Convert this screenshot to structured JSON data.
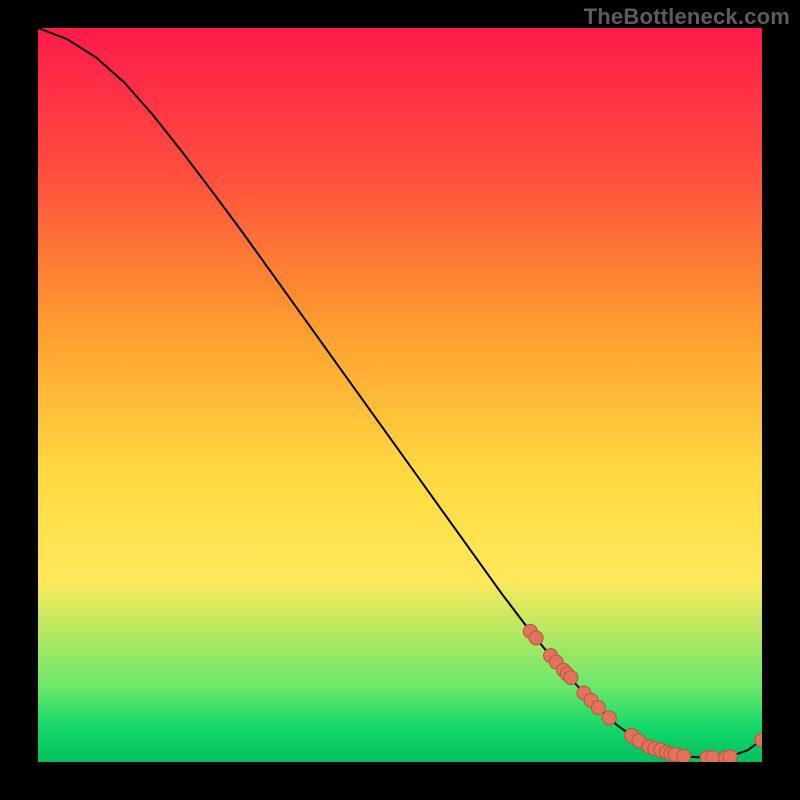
{
  "watermark": "TheBottleneck.com",
  "chart_data": {
    "type": "line",
    "title": "",
    "xlabel": "",
    "ylabel": "",
    "xlim": [
      0,
      100
    ],
    "ylim": [
      0,
      100
    ],
    "grid": false,
    "gradient_stops": [
      {
        "offset": 0.0,
        "color": "#ff1a4b"
      },
      {
        "offset": 0.2,
        "color": "#ff4f3e"
      },
      {
        "offset": 0.4,
        "color": "#ff9a2f"
      },
      {
        "offset": 0.6,
        "color": "#ffd83f"
      },
      {
        "offset": 0.75,
        "color": "#ffe95a"
      },
      {
        "offset": 0.9,
        "color": "#68e86a"
      },
      {
        "offset": 0.95,
        "color": "#17d86a"
      },
      {
        "offset": 1.0,
        "color": "#00c060"
      }
    ],
    "series": [
      {
        "name": "curve",
        "type": "line",
        "x": [
          0,
          4,
          8,
          12,
          16,
          20,
          24,
          28,
          32,
          36,
          40,
          44,
          48,
          52,
          56,
          60,
          64,
          68,
          72,
          76,
          80,
          82,
          84,
          86,
          88,
          90,
          92,
          94,
          96,
          98,
          100
        ],
        "y": [
          100,
          98.5,
          96.0,
          92.5,
          88.0,
          83.0,
          77.8,
          72.5,
          67.0,
          61.5,
          56.0,
          50.5,
          45.0,
          39.5,
          34.0,
          28.5,
          23.0,
          17.8,
          13.0,
          8.8,
          5.0,
          3.6,
          2.4,
          1.6,
          1.0,
          0.7,
          0.6,
          0.6,
          0.9,
          1.6,
          3.0
        ]
      },
      {
        "name": "markers",
        "type": "scatter",
        "x": [
          68.0,
          68.8,
          70.8,
          71.6,
          72.6,
          73.1,
          73.6,
          75.4,
          76.4,
          77.4,
          78.9,
          82.0,
          83.0,
          84.4,
          85.2,
          86.0,
          86.8,
          87.4,
          88.0,
          89.2,
          92.4,
          93.2,
          95.0,
          95.6,
          100.0
        ],
        "y": [
          17.8,
          16.9,
          14.5,
          13.6,
          12.5,
          12.0,
          11.5,
          9.4,
          8.4,
          7.4,
          6.0,
          3.6,
          2.9,
          2.1,
          1.8,
          1.6,
          1.3,
          1.1,
          1.0,
          0.8,
          0.6,
          0.6,
          0.6,
          0.7,
          3.0
        ]
      }
    ],
    "marker_style": {
      "radius_px": 7,
      "fill": "#e2725b",
      "stroke": "#b85640",
      "stroke_width": 1
    },
    "line_style": {
      "stroke": "#000000",
      "width": 2
    }
  }
}
